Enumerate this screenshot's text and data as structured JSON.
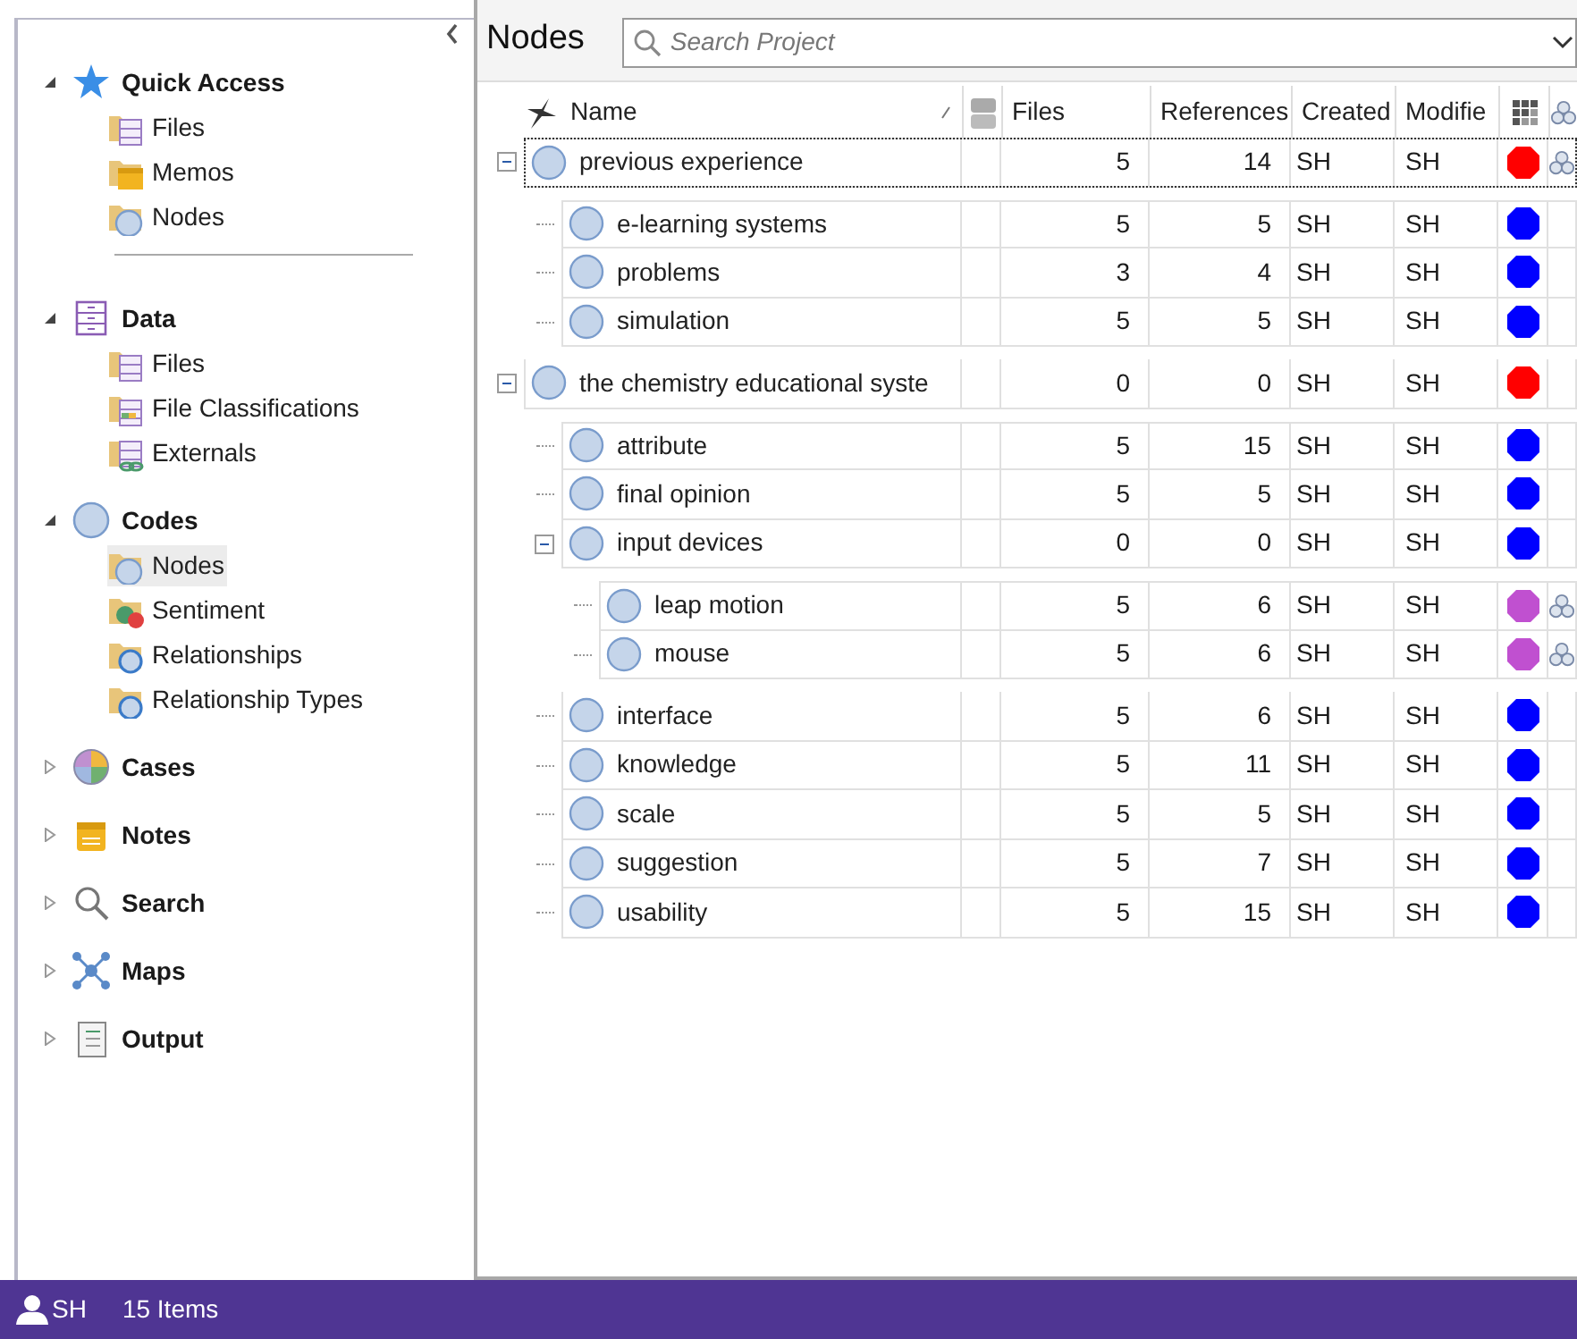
{
  "navigation": {
    "sections": [
      {
        "label": "Quick Access",
        "expanded": true,
        "divider_after": true,
        "items": [
          {
            "label": "Files",
            "selected": false
          },
          {
            "label": "Memos",
            "selected": false
          },
          {
            "label": "Nodes",
            "selected": false
          }
        ]
      },
      {
        "label": "Data",
        "expanded": true,
        "items": [
          {
            "label": "Files",
            "selected": false
          },
          {
            "label": "File Classifications",
            "selected": false
          },
          {
            "label": "Externals",
            "selected": false
          }
        ]
      },
      {
        "label": "Codes",
        "expanded": true,
        "items": [
          {
            "label": "Nodes",
            "selected": true
          },
          {
            "label": "Sentiment",
            "selected": false
          },
          {
            "label": "Relationships",
            "selected": false
          },
          {
            "label": "Relationship Types",
            "selected": false
          }
        ]
      },
      {
        "label": "Cases",
        "expanded": false
      },
      {
        "label": "Notes",
        "expanded": false
      },
      {
        "label": "Search",
        "expanded": false
      },
      {
        "label": "Maps",
        "expanded": false
      },
      {
        "label": "Output",
        "expanded": false
      }
    ]
  },
  "main": {
    "title": "Nodes",
    "search": {
      "placeholder": "Search Project"
    },
    "columns": {
      "name": "Name",
      "files": "Files",
      "references": "References",
      "created": "Created",
      "modified": "Modifie"
    },
    "nodes": [
      {
        "name": "previous experience",
        "files": "5",
        "references": "14",
        "created": "SH",
        "modified": "SH",
        "color": "#ff0000",
        "has_relationships": true,
        "selected": true,
        "expanded": true,
        "children": [
          {
            "name": "e-learning systems",
            "files": "5",
            "references": "5",
            "created": "SH",
            "modified": "SH",
            "color": "#0000ff",
            "has_relationships": false,
            "selected": false
          },
          {
            "name": "problems",
            "files": "3",
            "references": "4",
            "created": "SH",
            "modified": "SH",
            "color": "#0000ff",
            "has_relationships": false,
            "selected": false
          },
          {
            "name": "simulation",
            "files": "5",
            "references": "5",
            "created": "SH",
            "modified": "SH",
            "color": "#0000ff",
            "has_relationships": false,
            "selected": false
          }
        ]
      },
      {
        "name": "the chemistry educational syste",
        "files": "0",
        "references": "0",
        "created": "SH",
        "modified": "SH",
        "color": "#ff0000",
        "has_relationships": false,
        "selected": false,
        "expanded": true,
        "children": [
          {
            "name": "attribute",
            "files": "5",
            "references": "15",
            "created": "SH",
            "modified": "SH",
            "color": "#0000ff",
            "has_relationships": false,
            "selected": false
          },
          {
            "name": "final opinion",
            "files": "5",
            "references": "5",
            "created": "SH",
            "modified": "SH",
            "color": "#0000ff",
            "has_relationships": false,
            "selected": false
          },
          {
            "name": "input devices",
            "files": "0",
            "references": "0",
            "created": "SH",
            "modified": "SH",
            "color": "#0000ff",
            "has_relationships": false,
            "selected": false,
            "expanded": true,
            "children": [
              {
                "name": "leap motion",
                "files": "5",
                "references": "6",
                "created": "SH",
                "modified": "SH",
                "color": "#c050d0",
                "has_relationships": true,
                "selected": false
              },
              {
                "name": "mouse",
                "files": "5",
                "references": "6",
                "created": "SH",
                "modified": "SH",
                "color": "#c050d0",
                "has_relationships": true,
                "selected": false
              }
            ]
          },
          {
            "name": "interface",
            "files": "5",
            "references": "6",
            "created": "SH",
            "modified": "SH",
            "color": "#0000ff",
            "has_relationships": false,
            "selected": false
          },
          {
            "name": "knowledge",
            "files": "5",
            "references": "11",
            "created": "SH",
            "modified": "SH",
            "color": "#0000ff",
            "has_relationships": false,
            "selected": false
          },
          {
            "name": "scale",
            "files": "5",
            "references": "5",
            "created": "SH",
            "modified": "SH",
            "color": "#0000ff",
            "has_relationships": false,
            "selected": false
          },
          {
            "name": "suggestion",
            "files": "5",
            "references": "7",
            "created": "SH",
            "modified": "SH",
            "color": "#0000ff",
            "has_relationships": false,
            "selected": false
          },
          {
            "name": "usability",
            "files": "5",
            "references": "15",
            "created": "SH",
            "modified": "SH",
            "color": "#0000ff",
            "has_relationships": false,
            "selected": false
          }
        ]
      }
    ]
  },
  "status_bar": {
    "user": "SH",
    "count": "15 Items"
  }
}
